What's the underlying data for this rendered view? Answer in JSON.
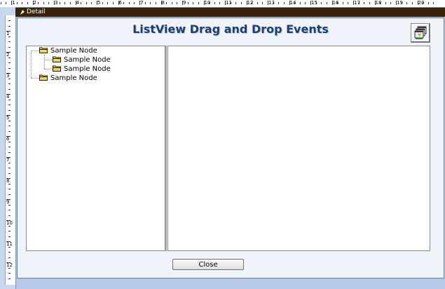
{
  "ruler": {
    "horizontal_numbers": [
      "1",
      "2",
      "3",
      "4",
      "5",
      "6",
      "7",
      "8",
      "9",
      "10",
      "11",
      "12",
      "13",
      "14",
      "15",
      "16",
      "17",
      "18",
      "19",
      "20"
    ],
    "vertical_numbers": [
      "1",
      "2",
      "3",
      "4",
      "5",
      "6",
      "7",
      "8",
      "9",
      "10",
      "11",
      "12"
    ]
  },
  "section": {
    "label": "Detail"
  },
  "form": {
    "title": "ListView Drag and Drop Events",
    "tree": {
      "nodes": [
        {
          "label": "Sample Node",
          "level": 0
        },
        {
          "label": "Sample Node",
          "level": 1
        },
        {
          "label": "Sample Node",
          "level": 1
        },
        {
          "label": "Sample Node",
          "level": 0
        }
      ]
    },
    "close_label": "Close"
  },
  "colors": {
    "section_bar": "#3a2408",
    "title": "#1f3d6e",
    "folder": "#f3d84a"
  },
  "icons": {
    "form_button": "windows-stack-icon",
    "section": "section-selector-icon",
    "node": "folder-icon"
  }
}
